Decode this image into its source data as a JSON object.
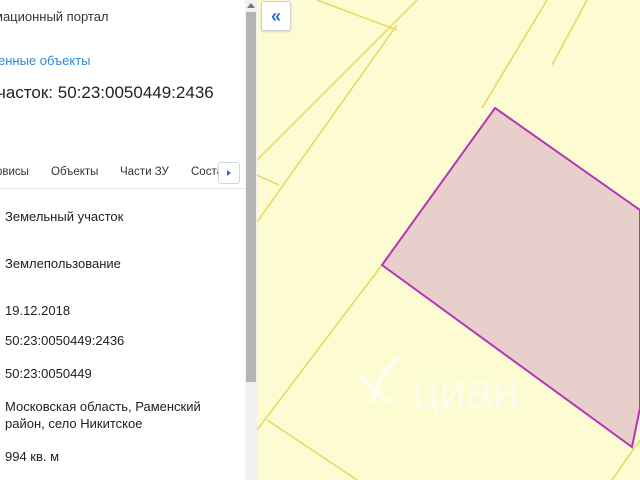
{
  "header": {
    "portal_title": "мационный портал",
    "saved_objects_link": "енные объекты",
    "plot_title": "часток: 50:23:0050449:2436"
  },
  "tabs": [
    {
      "label": "рвисы"
    },
    {
      "label": "Объекты"
    },
    {
      "label": "Части ЗУ"
    },
    {
      "label": "Соста"
    }
  ],
  "tabs_more_icon": "chevron-right-icon",
  "details": {
    "object_type": "Земельный участок",
    "category": "Землепользование",
    "date": "19.12.2018",
    "cadastral_number": "50:23:0050449:2436",
    "quarter": "50:23:0050449",
    "address": "Московская область, Раменский район, село Никитское",
    "area": "994 кв. м"
  },
  "map": {
    "collapse_button_icon": "«",
    "watermark_text": "циан",
    "colors": {
      "background": "#fdfbd2",
      "parcel_lines": "#e8d75a",
      "selected_fill": "#e9cfcb",
      "selected_stroke": "#b535b5"
    }
  }
}
